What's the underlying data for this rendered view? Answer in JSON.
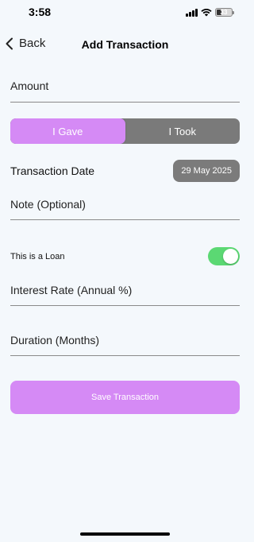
{
  "status_bar": {
    "time": "3:58",
    "battery_level": "33",
    "icons": [
      "signal-icon",
      "wifi-icon",
      "battery-icon"
    ]
  },
  "nav": {
    "back_label": "Back",
    "title": "Add Transaction"
  },
  "form": {
    "amount_placeholder": "Amount",
    "direction": {
      "options": [
        "I Gave",
        "I Took"
      ],
      "selected": "I Gave"
    },
    "date_label": "Transaction Date",
    "date_value": "29 May 2025",
    "note_placeholder": "Note (Optional)",
    "loan_label": "This is a Loan",
    "loan_enabled": true,
    "interest_placeholder": "Interest Rate (Annual %)",
    "duration_placeholder": "Duration (Months)",
    "save_label": "Save Transaction"
  },
  "colors": {
    "accent": "#d58af5",
    "segment_inactive": "#7a7a7a",
    "toggle_on": "#5bd873",
    "background": "#f4f8fc"
  }
}
